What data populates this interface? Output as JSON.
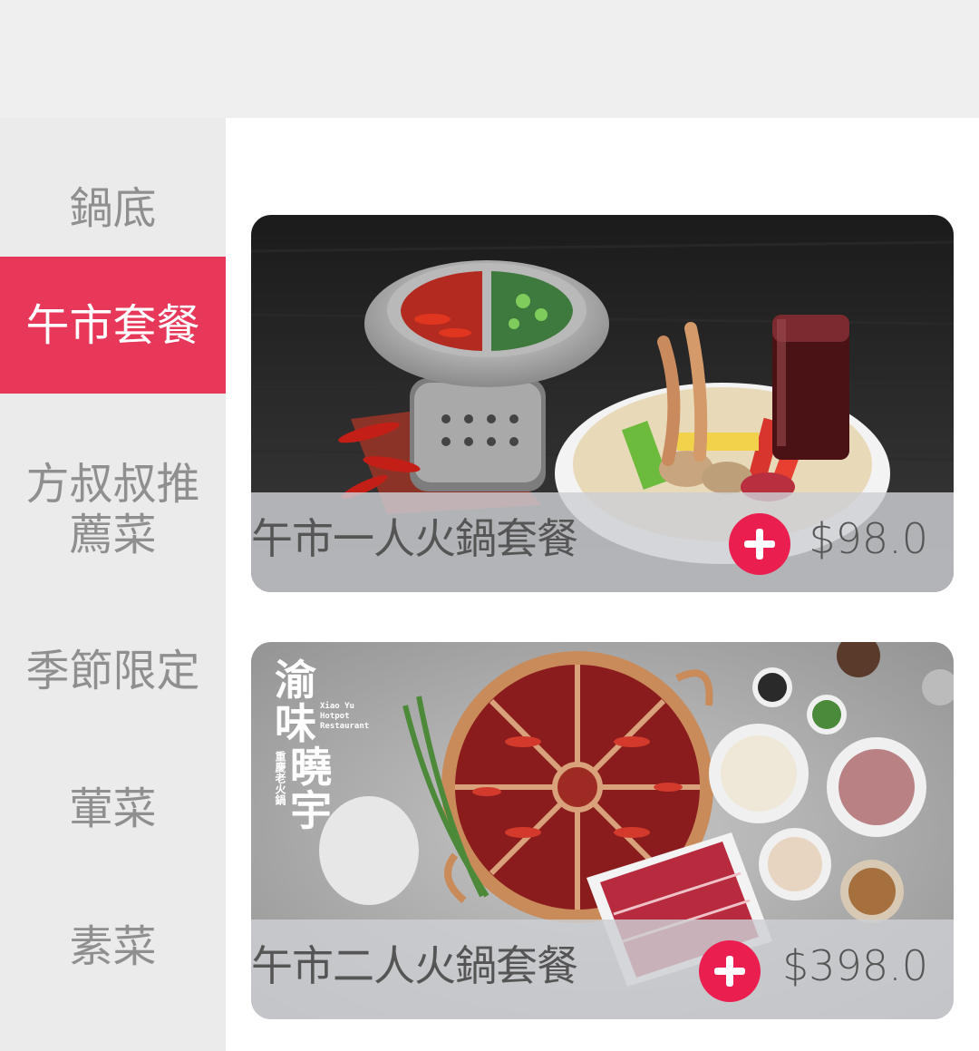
{
  "sidebar": {
    "items": [
      {
        "label": "鍋底"
      },
      {
        "label": "午市套餐"
      },
      {
        "label": "方叔叔推薦菜"
      },
      {
        "label": "季節限定"
      },
      {
        "label": "葷菜"
      },
      {
        "label": "素菜"
      }
    ],
    "active_index": 1
  },
  "products": [
    {
      "name": "午市一人火鍋套餐",
      "price": "$98.0",
      "add_icon": "plus-icon"
    },
    {
      "name": "午市二人火鍋套餐",
      "price": "$398.0",
      "add_icon": "plus-icon"
    }
  ],
  "logo": {
    "line1": "渝",
    "line2": "味",
    "line3": "曉",
    "line4": "宇",
    "en1": "Xiao Yu",
    "en2": "Hotpot",
    "en3": "Restaurant",
    "vertical": "重慶老火鍋"
  },
  "colors": {
    "accent": "#e8385a",
    "add_button": "#ea1f4f",
    "sidebar_bg": "#ebebeb",
    "topbar_bg": "#efefef"
  }
}
